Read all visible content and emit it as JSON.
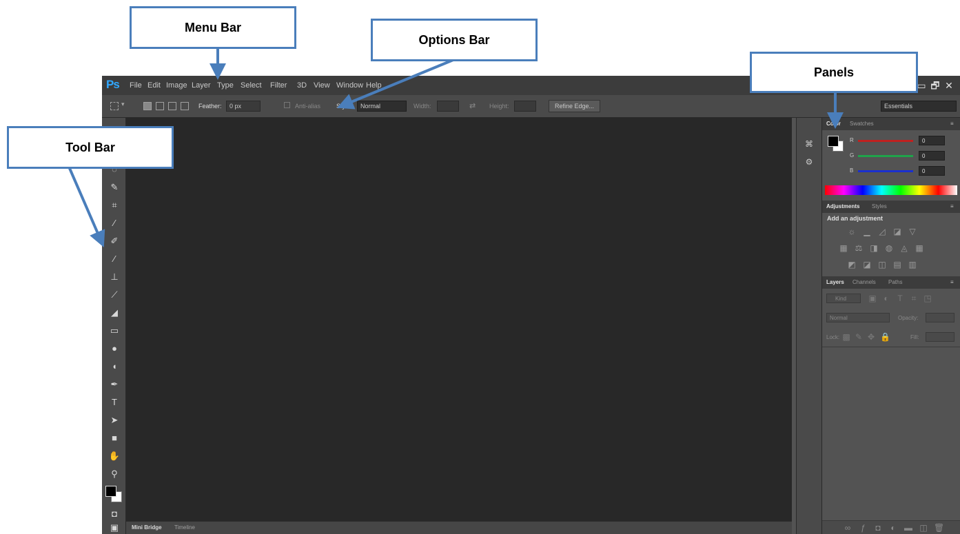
{
  "app": {
    "logo": "Ps",
    "window_controls": [
      "▭",
      "🗗",
      "✕"
    ]
  },
  "menu": [
    {
      "label": "File"
    },
    {
      "label": "Edit"
    },
    {
      "label": "Image"
    },
    {
      "label": "Layer"
    },
    {
      "label": "Type"
    },
    {
      "label": "Select"
    },
    {
      "label": "Filter"
    },
    {
      "label": "3D"
    },
    {
      "label": "View"
    },
    {
      "label": "Window"
    },
    {
      "label": "Help"
    }
  ],
  "options_bar": {
    "feather_label": "Feather:",
    "feather_value": "0 px",
    "anti_alias_label": "Anti-alias",
    "style_label": "Style:",
    "style_value": "Normal",
    "width_label": "Width:",
    "height_label": "Height:",
    "refine_edge_label": "Refine Edge...",
    "workspace_value": "Essentials"
  },
  "bottom_tabs": [
    "Mini Bridge",
    "Timeline"
  ],
  "color_panel": {
    "tabs": [
      "Color",
      "Swatches"
    ],
    "r_label": "R",
    "g_label": "G",
    "b_label": "B",
    "r_value": "0",
    "g_value": "0",
    "b_value": "0",
    "colors": {
      "r": "#c0201f",
      "g": "#1fa34a",
      "b": "#1a2fcf"
    }
  },
  "adjustments_panel": {
    "tabs": [
      "Adjustments",
      "Styles"
    ],
    "heading": "Add an adjustment"
  },
  "layers_panel": {
    "tabs": [
      "Layers",
      "Channels",
      "Paths"
    ],
    "kind_value": "Kind",
    "blend_value": "Normal",
    "opacity_label": "Opacity:",
    "lock_label": "Lock:",
    "fill_label": "Fill:"
  },
  "callouts": {
    "menu_bar": "Menu Bar",
    "options_bar": "Options Bar",
    "panels": "Panels",
    "tool_bar": "Tool Bar"
  },
  "accent_colors": {
    "callout_border": "#4a7ebb",
    "canvas": "#282828",
    "ps_logo": "#31a8ff"
  }
}
